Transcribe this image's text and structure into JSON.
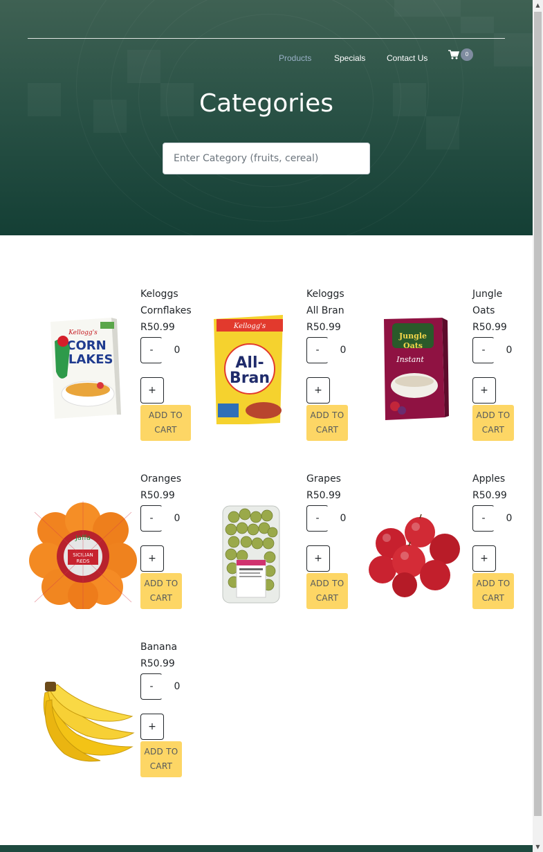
{
  "nav": {
    "items": [
      {
        "label": "Products",
        "active": true
      },
      {
        "label": "Specials",
        "active": false
      },
      {
        "label": "Contact Us",
        "active": false
      }
    ],
    "cart_count": "0",
    "cart_icon": "shopping-cart-icon"
  },
  "hero": {
    "title": "Categories",
    "search_placeholder": "Enter Category (fruits, cereal)"
  },
  "buttons": {
    "minus": "-",
    "plus": "+",
    "add_to_cart": "ADD TO CART"
  },
  "products": [
    {
      "name": "Keloggs Cornflakes",
      "price": "R50.99",
      "qty": "0",
      "image": "cornflakes-box"
    },
    {
      "name": "Keloggs All Bran",
      "price": "R50.99",
      "qty": "0",
      "image": "all-bran-box"
    },
    {
      "name": "Jungle Oats",
      "price": "R50.99",
      "qty": "0",
      "image": "jungle-oats-box"
    },
    {
      "name": "Oranges",
      "price": "R50.99",
      "qty": "0",
      "image": "oranges-bag"
    },
    {
      "name": "Grapes",
      "price": "R50.99",
      "qty": "0",
      "image": "grapes-punnet"
    },
    {
      "name": "Apples",
      "price": "R50.99",
      "qty": "0",
      "image": "apples"
    },
    {
      "name": "Banana",
      "price": "R50.99",
      "qty": "0",
      "image": "banana-bunch"
    }
  ],
  "colors": {
    "hero_green": "#2a5246",
    "add_button": "#fdd665",
    "nav_active": "#9ab1c7",
    "badge": "#7f8ca0"
  }
}
